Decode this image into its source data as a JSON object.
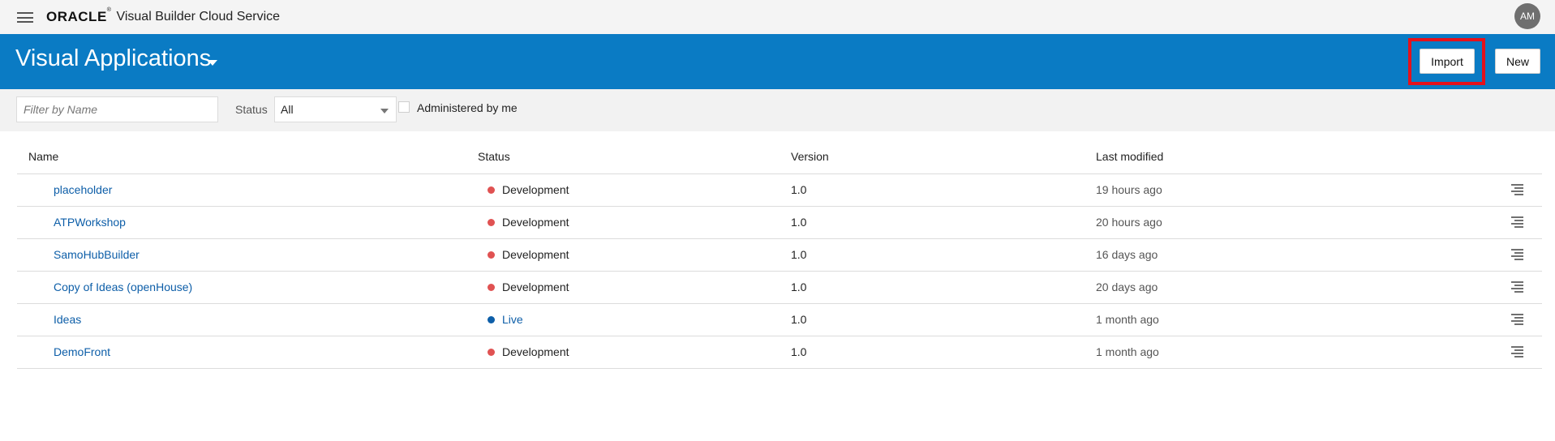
{
  "topbar": {
    "logo": "ORACLE",
    "logo_mark": "®",
    "product": "Visual Builder Cloud Service",
    "avatar_initials": "AM"
  },
  "header": {
    "title": "Visual Applications",
    "import_label": "Import",
    "new_label": "New",
    "background_color": "#0a7bc4",
    "highlight_color": "#e5111b"
  },
  "filters": {
    "name_placeholder": "Filter by Name",
    "name_value": "",
    "status_label": "Status",
    "status_selected": "All",
    "administered_label": "Administered by me",
    "administered_checked": false
  },
  "table": {
    "columns": [
      "Name",
      "Status",
      "Version",
      "Last modified"
    ],
    "rows": [
      {
        "name": "placeholder",
        "status": "Development",
        "status_color": "#e05252",
        "version": "1.0",
        "modified": "19 hours ago"
      },
      {
        "name": "ATPWorkshop",
        "status": "Development",
        "status_color": "#e05252",
        "version": "1.0",
        "modified": "20 hours ago"
      },
      {
        "name": "SamoHubBuilder",
        "status": "Development",
        "status_color": "#e05252",
        "version": "1.0",
        "modified": "16 days ago"
      },
      {
        "name": "Copy of Ideas (openHouse)",
        "status": "Development",
        "status_color": "#e05252",
        "version": "1.0",
        "modified": "20 days ago"
      },
      {
        "name": "Ideas",
        "status": "Live",
        "status_color": "#0d5ea8",
        "version": "1.0",
        "modified": "1 month ago"
      },
      {
        "name": "DemoFront",
        "status": "Development",
        "status_color": "#e05252",
        "version": "1.0",
        "modified": "1 month ago"
      }
    ]
  }
}
